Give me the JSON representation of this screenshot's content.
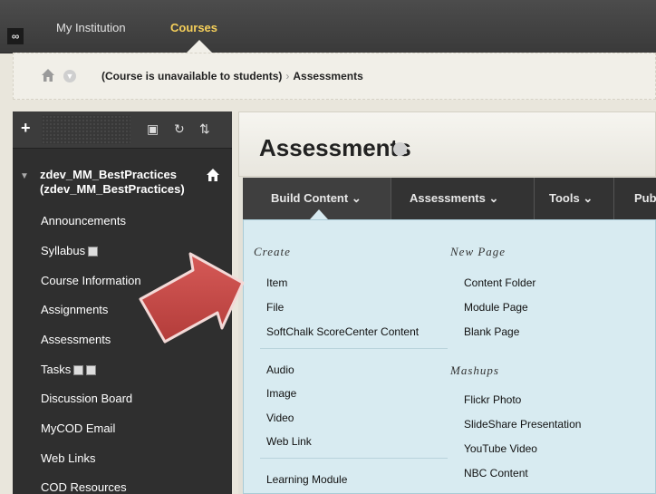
{
  "topnav": {
    "items": [
      "My Institution",
      "Courses"
    ]
  },
  "breadcrumb": {
    "course": "(Course is unavailable to students)",
    "separator": "›",
    "current": "Assessments"
  },
  "sidebar": {
    "course_title_line1": "zdev_MM_BestPractices",
    "course_title_line2": "(zdev_MM_BestPractices)",
    "items": [
      "Announcements",
      "Syllabus",
      "Course Information",
      "Assignments",
      "Assessments",
      "Tasks",
      "Discussion Board",
      "MyCOD Email",
      "Web Links",
      "COD Resources"
    ]
  },
  "main": {
    "title": "Assessments",
    "actionbar": [
      "Build Content",
      "Assessments",
      "Tools",
      "Pub"
    ]
  },
  "dropdown": {
    "create_heading": "Create",
    "create_items": [
      "Item",
      "File",
      "SoftChalk ScoreCenter Content"
    ],
    "media_items": [
      "Audio",
      "Image",
      "Video",
      "Web Link"
    ],
    "module_items": [
      "Learning Module"
    ],
    "newpage_heading": "New Page",
    "newpage_items": [
      "Content Folder",
      "Module Page",
      "Blank Page"
    ],
    "mashups_heading": "Mashups",
    "mashups_items": [
      "Flickr Photo",
      "SlideShare Presentation",
      "YouTube Video",
      "NBC Content"
    ]
  },
  "colors": {
    "topbar": "#3f3f3f",
    "courses_active": "#f5cf5a",
    "sidebar": "#2f2f2f",
    "dropdown": "#d8ebf1",
    "arrow": "#c94a48"
  }
}
